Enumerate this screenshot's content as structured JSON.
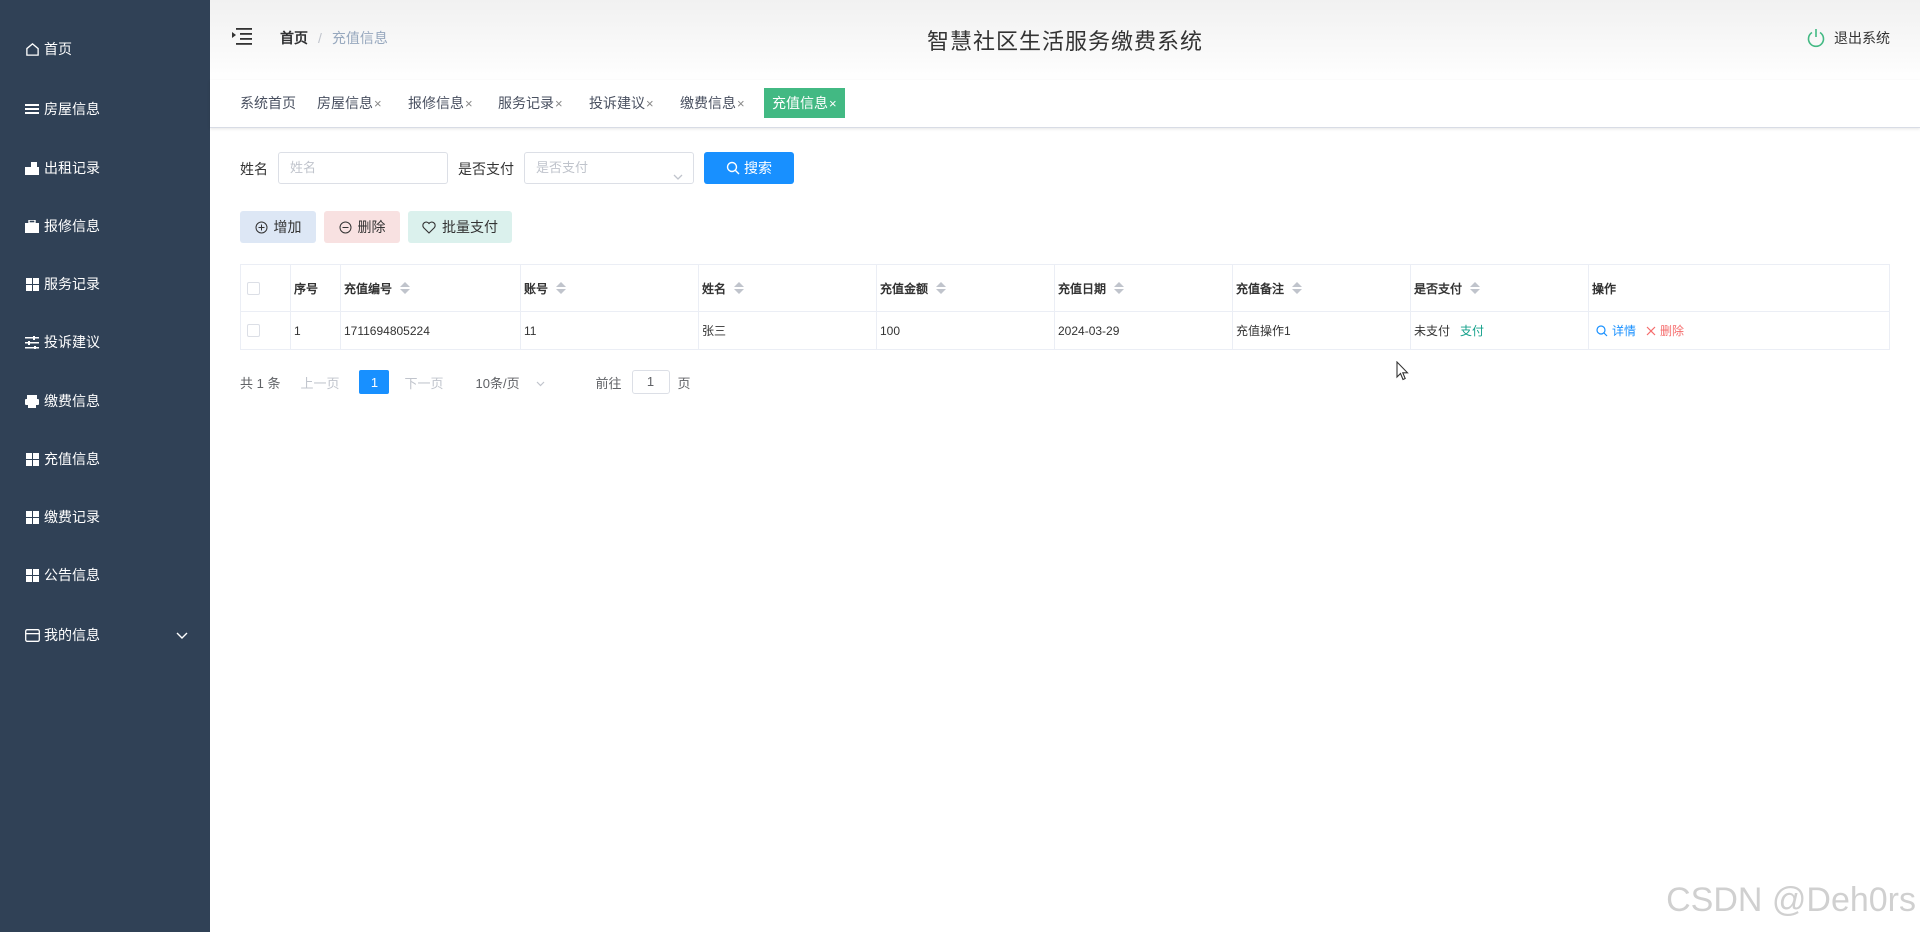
{
  "sidebar": {
    "items": [
      {
        "label": "首页",
        "icon": "home-icon"
      },
      {
        "label": "房屋信息",
        "icon": "list-icon"
      },
      {
        "label": "出租记录",
        "icon": "bag-icon"
      },
      {
        "label": "报修信息",
        "icon": "briefcase-icon"
      },
      {
        "label": "服务记录",
        "icon": "grid-icon"
      },
      {
        "label": "投诉建议",
        "icon": "sliders-icon"
      },
      {
        "label": "缴费信息",
        "icon": "printer-icon"
      },
      {
        "label": "充值信息",
        "icon": "grid-icon"
      },
      {
        "label": "缴费记录",
        "icon": "grid-icon"
      },
      {
        "label": "公告信息",
        "icon": "grid-icon"
      },
      {
        "label": "我的信息",
        "icon": "card-icon"
      }
    ]
  },
  "header": {
    "breadcrumb_home": "首页",
    "breadcrumb_sep": "/",
    "breadcrumb_current": "充值信息",
    "title": "智慧社区生活服务缴费系统",
    "logout_label": "退出系统"
  },
  "tabs": [
    {
      "label": "系统首页",
      "closable": false
    },
    {
      "label": "房屋信息",
      "closable": true
    },
    {
      "label": "报修信息",
      "closable": true
    },
    {
      "label": "服务记录",
      "closable": true
    },
    {
      "label": "投诉建议",
      "closable": true
    },
    {
      "label": "缴费信息",
      "closable": true
    },
    {
      "label": "充值信息",
      "closable": true,
      "active": true
    }
  ],
  "tab_close_glyph": "×",
  "search": {
    "name_label": "姓名",
    "name_placeholder": "姓名",
    "paid_label": "是否支付",
    "paid_placeholder": "是否支付",
    "search_button": "搜索"
  },
  "actions": {
    "add": "增加",
    "delete": "删除",
    "batch_pay": "批量支付"
  },
  "table": {
    "columns": [
      "序号",
      "充值编号",
      "账号",
      "姓名",
      "充值金额",
      "充值日期",
      "充值备注",
      "是否支付",
      "操作"
    ],
    "rows": [
      {
        "index": "1",
        "recharge_no": "1711694805224",
        "account": "11",
        "name": "张三",
        "amount": "100",
        "date": "2024-03-29",
        "remark": "充值操作1",
        "paid_status": "未支付",
        "pay_link": "支付",
        "detail": "详情",
        "delete": "删除"
      }
    ]
  },
  "pagination": {
    "total": "共 1 条",
    "prev": "上一页",
    "current_page": "1",
    "next": "下一页",
    "page_size": "10条/页",
    "goto_label": "前往",
    "goto_value": "1",
    "page_suffix": "页"
  },
  "watermark": "CSDN @Deh0rs",
  "colors": {
    "sidebar_bg": "#304156",
    "active_tab": "#42b983",
    "primary": "#1890ff",
    "danger": "#f56c6c",
    "pay_link": "#13a08a"
  }
}
